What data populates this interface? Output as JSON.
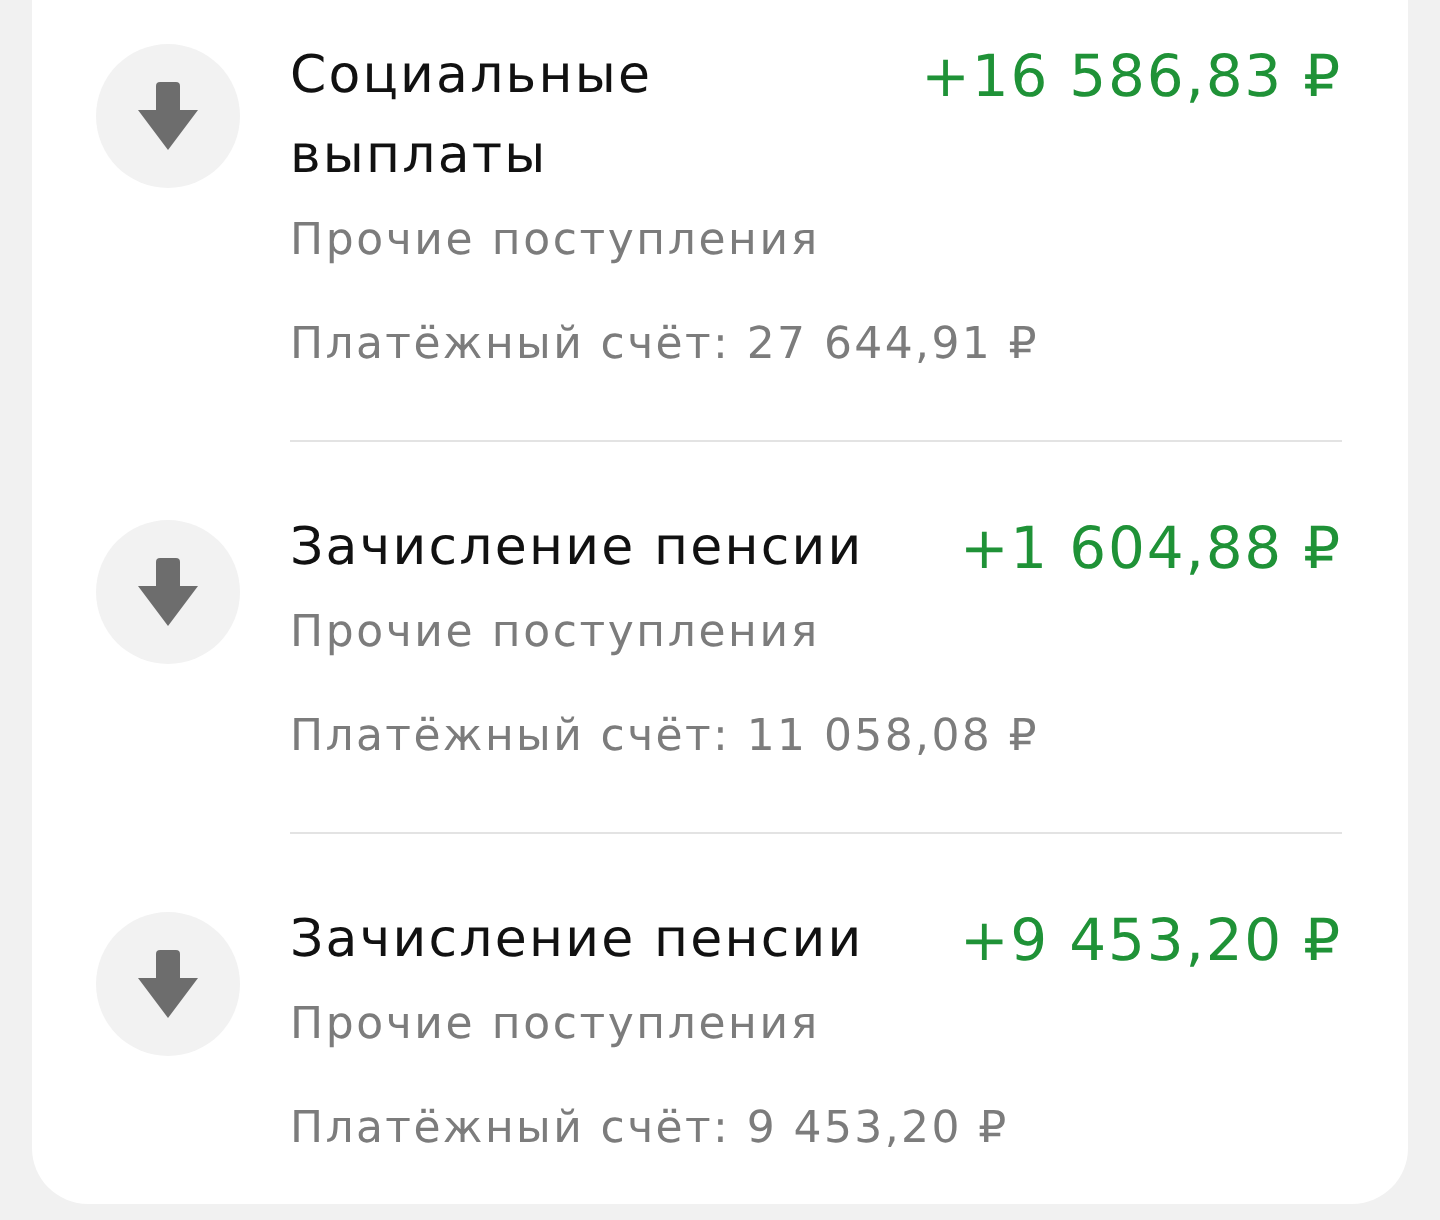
{
  "transactions": [
    {
      "kind": "incoming",
      "title": "Социальные выплаты",
      "amount": "+16 586,83 ₽",
      "category": "Прочие поступления",
      "account": "Платёжный счёт: 27 644,91 ₽"
    },
    {
      "kind": "incoming",
      "title": "Зачисление пенсии",
      "amount": "+1 604,88 ₽",
      "category": "Прочие поступления",
      "account": "Платёжный счёт: 11 058,08 ₽"
    },
    {
      "kind": "incoming",
      "title": "Зачисление пенсии",
      "amount": "+9 453,20 ₽",
      "category": "Прочие поступления",
      "account": "Платёжный счёт: 9 453,20 ₽"
    }
  ]
}
